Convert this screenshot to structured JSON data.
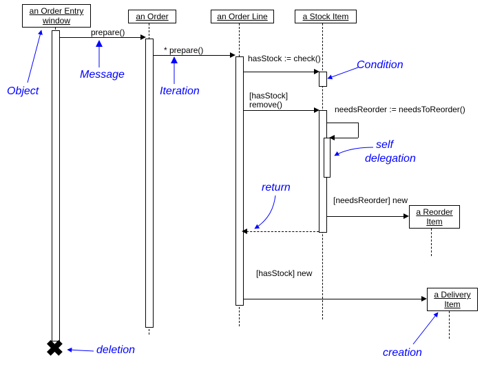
{
  "objects": {
    "orderEntryWindow": "an Order Entry window",
    "order": "an Order",
    "orderLine": "an Order Line",
    "stockItem": "a Stock Item",
    "reorderItem": "a Reorder Item",
    "deliveryItem": "a Delivery Item"
  },
  "messages": {
    "prepare1": "prepare()",
    "prepare2": "* prepare()",
    "check": "hasStock := check()",
    "remove_guard": "[hasStock]",
    "remove": "remove()",
    "needsReorder": "needsReorder := needsToReorder()",
    "newReorder": "[needsReorder] new",
    "newDelivery": "[hasStock] new"
  },
  "annotations": {
    "object": "Object",
    "message": "Message",
    "iteration": "Iteration",
    "condition": "Condition",
    "selfDelegation1": "self",
    "selfDelegation2": "delegation",
    "return": "return",
    "deletion": "deletion",
    "creation": "creation"
  },
  "chart_data": {
    "type": "uml-sequence-diagram",
    "lifelines": [
      "an Order Entry window",
      "an Order",
      "an Order Line",
      "a Stock Item",
      "a Reorder Item",
      "a Delivery Item"
    ],
    "messages": [
      {
        "from": "an Order Entry window",
        "to": "an Order",
        "label": "prepare()",
        "kind": "sync"
      },
      {
        "from": "an Order",
        "to": "an Order Line",
        "label": "* prepare()",
        "kind": "sync",
        "iteration": true
      },
      {
        "from": "an Order Line",
        "to": "a Stock Item",
        "label": "hasStock := check()",
        "kind": "sync"
      },
      {
        "from": "an Order Line",
        "to": "a Stock Item",
        "label": "remove()",
        "guard": "[hasStock]",
        "kind": "sync"
      },
      {
        "from": "a Stock Item",
        "to": "a Stock Item",
        "label": "needsReorder := needsToReorder()",
        "kind": "self"
      },
      {
        "from": "a Stock Item",
        "to": "a Reorder Item",
        "label": "new",
        "guard": "[needsReorder]",
        "kind": "create"
      },
      {
        "from": "a Stock Item",
        "to": "an Order Line",
        "label": "",
        "kind": "return"
      },
      {
        "from": "an Order Line",
        "to": "a Delivery Item",
        "label": "new",
        "guard": "[hasStock]",
        "kind": "create"
      },
      {
        "from": "an Order Entry window",
        "to": "an Order Entry window",
        "label": "",
        "kind": "destroy"
      }
    ],
    "annotations": [
      "Object",
      "Message",
      "Iteration",
      "Condition",
      "self delegation",
      "return",
      "deletion",
      "creation"
    ]
  }
}
